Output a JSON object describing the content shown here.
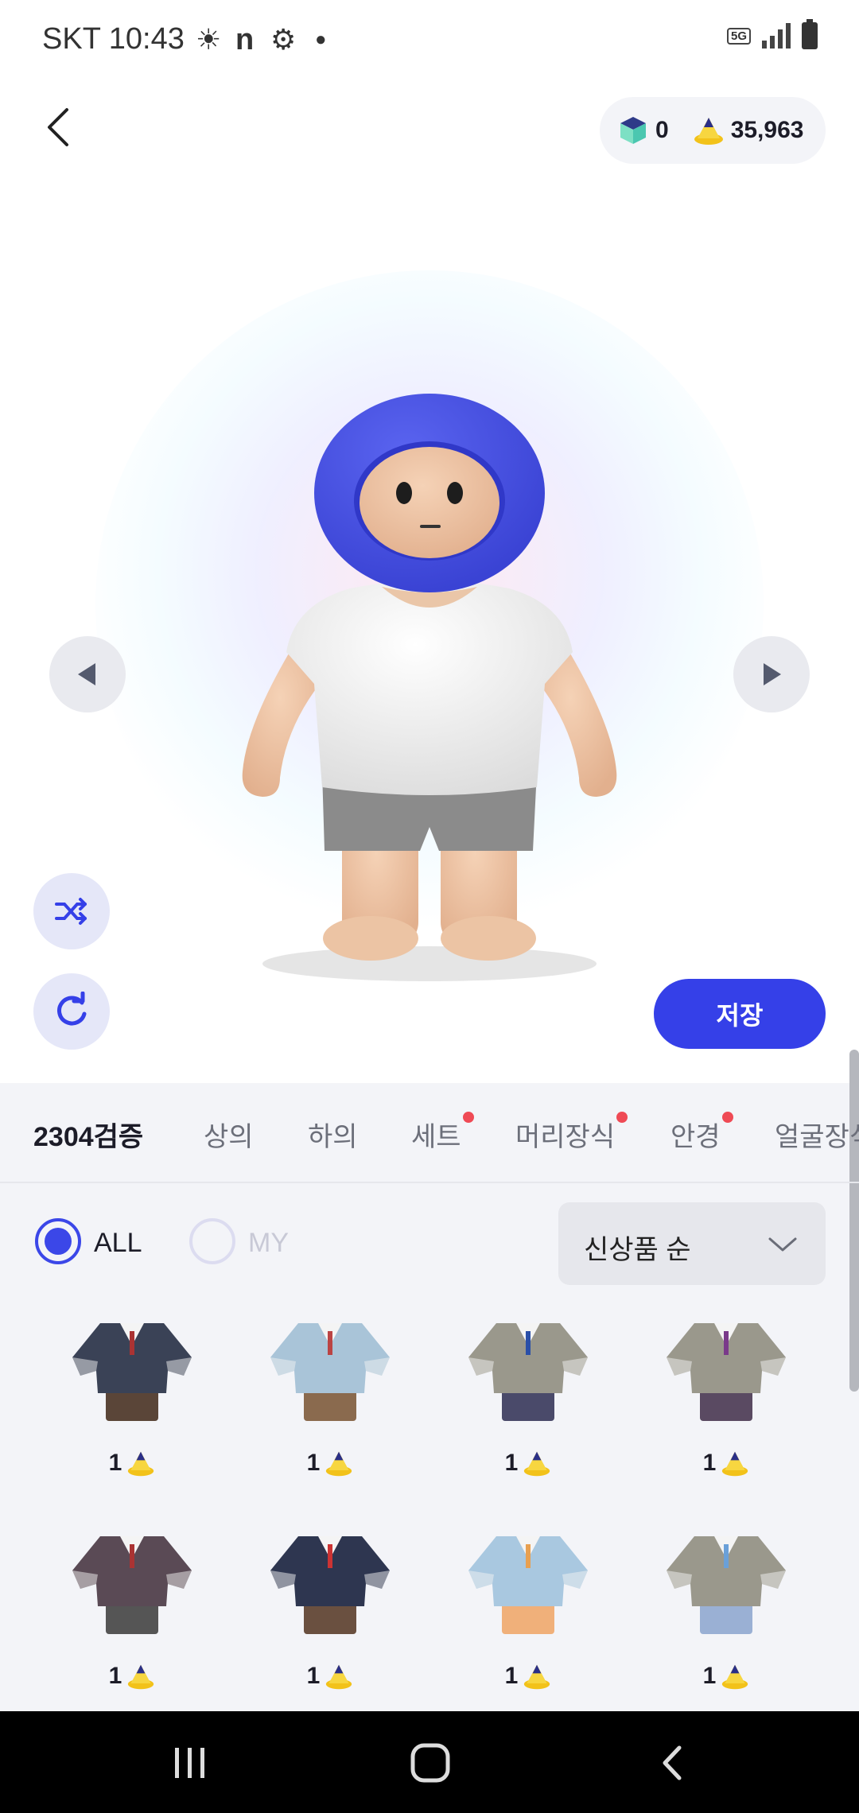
{
  "status_bar": {
    "carrier_time": "SKT 10:43",
    "network": "5G"
  },
  "header": {
    "cube_count": "0",
    "coin_count": "35,963"
  },
  "actions": {
    "save_label": "저장"
  },
  "tabs": [
    {
      "label": "2304검증",
      "active": true,
      "dot": false
    },
    {
      "label": "상의",
      "active": false,
      "dot": false
    },
    {
      "label": "하의",
      "active": false,
      "dot": false
    },
    {
      "label": "세트",
      "active": false,
      "dot": true
    },
    {
      "label": "머리장식",
      "active": false,
      "dot": true
    },
    {
      "label": "안경",
      "active": false,
      "dot": true
    },
    {
      "label": "얼굴장식",
      "active": false,
      "dot": false
    }
  ],
  "filters": {
    "all_label": "ALL",
    "my_label": "MY",
    "sort_label": "신상품 순"
  },
  "items": [
    {
      "price": "1",
      "jacket": "#3a4256",
      "bottom": "#5a4538",
      "tie": "#a33"
    },
    {
      "price": "1",
      "jacket": "#a9c4d8",
      "bottom": "#8a6a4e",
      "tie": "#b44"
    },
    {
      "price": "1",
      "jacket": "#9a988c",
      "bottom": "#4a4a6a",
      "tie": "#2a4fa8"
    },
    {
      "price": "1",
      "jacket": "#9a988c",
      "bottom": "#5a4a62",
      "tie": "#7a3a8a"
    },
    {
      "price": "1",
      "jacket": "#5a4a55",
      "bottom": "#555",
      "tie": "#a33"
    },
    {
      "price": "1",
      "jacket": "#2e3650",
      "bottom": "#6a5040",
      "tie": "#c33"
    },
    {
      "price": "1",
      "jacket": "#a9c8e0",
      "bottom": "#f0b07a",
      "tie": "#e8a050"
    },
    {
      "price": "1",
      "jacket": "#9a988c",
      "bottom": "#9ab0d4",
      "tie": "#6aa0d8"
    }
  ],
  "colors": {
    "accent": "#3540e8",
    "hood": "#4a54e0",
    "panel": "#f3f4f8"
  }
}
